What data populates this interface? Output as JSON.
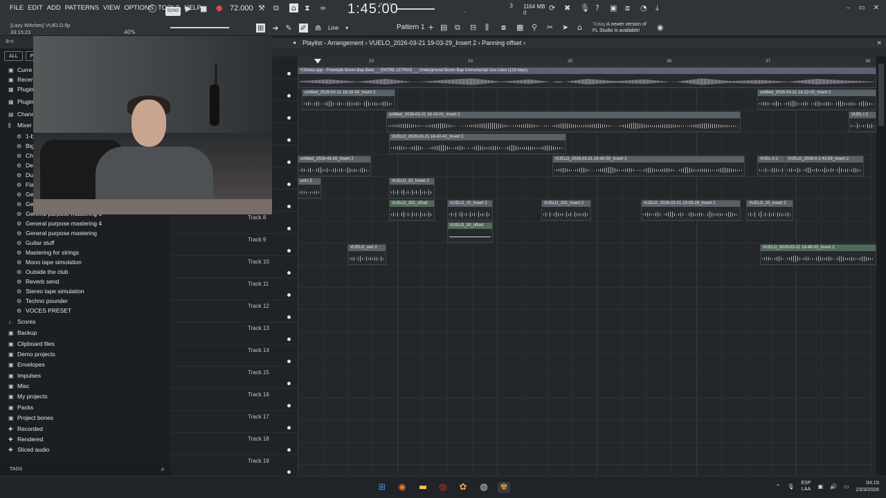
{
  "menu": [
    "FILE",
    "EDIT",
    "ADD",
    "PATTERNS",
    "VIEW",
    "OPTIONS",
    "TOOLS",
    "HELP"
  ],
  "transport": {
    "song_label": "SONG",
    "tempo": "72.000",
    "time": "1:45:00",
    "time_sub": "M:S:CS",
    "cpu": "3",
    "memory": "1164 MB",
    "memory_sub": "0"
  },
  "project": {
    "title": "[Lazy Witches] VUELO.flp",
    "elapsed": "33:15:23",
    "zoom": "40%"
  },
  "toolbar": {
    "snap": "Line",
    "pattern": "Pattern 1"
  },
  "news": {
    "label": "Today",
    "text": "A newer version of",
    "text2": "FL Studio is available!"
  },
  "browser": {
    "header": "Bro",
    "tabs": [
      "ALL",
      "P"
    ],
    "items": [
      {
        "icon": "folder",
        "label": "Curre"
      },
      {
        "icon": "folder",
        "label": "Recen"
      },
      {
        "icon": "plugin",
        "label": "Plugin"
      },
      {
        "icon": "plugin",
        "label": "Plugin"
      },
      {
        "icon": "channel",
        "label": "Chann"
      },
      {
        "icon": "mixer",
        "label": "Mixer"
      },
      {
        "icon": "gear",
        "label": "1-b"
      },
      {
        "icon": "gear",
        "label": "Big"
      },
      {
        "icon": "gear",
        "label": "Cho"
      },
      {
        "icon": "gear",
        "label": "Def"
      },
      {
        "icon": "gear",
        "label": "Dua"
      },
      {
        "icon": "gear",
        "label": "Fla"
      },
      {
        "icon": "gear",
        "label": "Gen"
      },
      {
        "icon": "gear",
        "label": "Gen"
      },
      {
        "icon": "gear",
        "label": "General purpose mastering 3"
      },
      {
        "icon": "gear",
        "label": "General purpose mastering 4"
      },
      {
        "icon": "gear",
        "label": "General purpose mastering"
      },
      {
        "icon": "gear",
        "label": "Guitar stuff"
      },
      {
        "icon": "gear",
        "label": "Mastering for strings"
      },
      {
        "icon": "gear",
        "label": "Mono tape simulation"
      },
      {
        "icon": "gear",
        "label": "Outside the club"
      },
      {
        "icon": "gear",
        "label": "Reverb send"
      },
      {
        "icon": "gear",
        "label": "Stereo tape simulation"
      },
      {
        "icon": "gear",
        "label": "Techno pounder"
      },
      {
        "icon": "gear",
        "label": "VOCES PRESET"
      },
      {
        "icon": "note",
        "label": "Scores"
      },
      {
        "icon": "folder",
        "label": "Backup"
      },
      {
        "icon": "folder",
        "label": "Clipboard files"
      },
      {
        "icon": "folder",
        "label": "Demo projects"
      },
      {
        "icon": "folder",
        "label": "Envelopes"
      },
      {
        "icon": "folder",
        "label": "Impulses"
      },
      {
        "icon": "folder",
        "label": "Misc"
      },
      {
        "icon": "folder",
        "label": "My projects"
      },
      {
        "icon": "folder",
        "label": "Packs"
      },
      {
        "icon": "folder",
        "label": "Project bones"
      },
      {
        "icon": "plus",
        "label": "Recorded"
      },
      {
        "icon": "plus",
        "label": "Rendered"
      },
      {
        "icon": "plus",
        "label": "Sliced audio"
      }
    ],
    "tags": "TAGS"
  },
  "playlist": {
    "title": "Playlist - Arrangement › VUELO_2026-03-21 19-03-29_Insert 2 › Panning offset ›",
    "bars": [
      "33",
      "34",
      "35",
      "36",
      "37",
      "38"
    ],
    "tracks": [
      "",
      "",
      "",
      "",
      "",
      "",
      "",
      "Track 8",
      "Track 9",
      "Track 10",
      "Track 11",
      "Track 12",
      "Track 13",
      "Track 14",
      "Track 15",
      "Track 16",
      "Track 17",
      "Track 18",
      "Track 19"
    ],
    "clips": [
      {
        "track": 0,
        "start": 0,
        "end": 836,
        "label": "Y2meta.app - Freestyle Boom Bap Beat _ _ENTRE LETRAS_ _ Underground Boom Bap Instrumental Uso Libre (128 kbps)",
        "kind": "long"
      },
      {
        "track": 1,
        "start": 6,
        "end": 141,
        "label": "untitled_2026-03-21 18-16-34_Insert 2",
        "kind": "audio"
      },
      {
        "track": 1,
        "start": 664,
        "end": 836,
        "label": "untitled_2026-03-21 18-22-00_Insert 2",
        "kind": "audio"
      },
      {
        "track": 2,
        "start": 128,
        "end": 640,
        "label": "untitled_2026-03-21 18-19-01_Insert 2",
        "kind": "audio"
      },
      {
        "track": 2,
        "start": 796,
        "end": 836,
        "label": "VUEL t 2",
        "kind": "audio"
      },
      {
        "track": 3,
        "start": 132,
        "end": 388,
        "label": "VUELO_2026-03-21 18-42-41_Insert 2",
        "kind": "audio"
      },
      {
        "track": 4,
        "start": 0,
        "end": 106,
        "label": "untitled_2026-43-16_Insert 2",
        "kind": "audio"
      },
      {
        "track": 4,
        "start": 368,
        "end": 646,
        "label": "VUELO_2026-03-21 18-42-59_Insert 2",
        "kind": "audio"
      },
      {
        "track": 4,
        "start": 664,
        "end": 706,
        "label": "VUEL rt 2",
        "kind": "audio"
      },
      {
        "track": 4,
        "start": 704,
        "end": 818,
        "label": "VUELO_2026-0-2 42-59_Insert 2",
        "kind": "audio"
      },
      {
        "track": 5,
        "start": 0,
        "end": 34,
        "label": "unt t 2",
        "kind": "audio"
      },
      {
        "track": 5,
        "start": 132,
        "end": 198,
        "label": "VUELO_20_Insert 2",
        "kind": "audio"
      },
      {
        "track": 6,
        "start": 132,
        "end": 198,
        "label": "VUELO_202_offset",
        "kind": "auto"
      },
      {
        "track": 6,
        "start": 216,
        "end": 282,
        "label": "VUELO_20_Insert 2",
        "kind": "audio"
      },
      {
        "track": 6,
        "start": 352,
        "end": 424,
        "label": "VUELO_202_Insert 2",
        "kind": "audio"
      },
      {
        "track": 6,
        "start": 496,
        "end": 640,
        "label": "VUELO_2026-03-21 19-03-29_Insert 2",
        "kind": "audio"
      },
      {
        "track": 6,
        "start": 648,
        "end": 716,
        "label": "VUELO_20_Insert 2",
        "kind": "audio"
      },
      {
        "track": 7,
        "start": 216,
        "end": 282,
        "label": "VUELO_20_offset",
        "kind": "auto"
      },
      {
        "track": 8,
        "start": 72,
        "end": 128,
        "label": "VUELO_sert 2",
        "kind": "audio"
      },
      {
        "track": 8,
        "start": 668,
        "end": 836,
        "label": "VUELO_2026-03-21 18-48-33_Insert 2",
        "kind": "auto"
      }
    ]
  },
  "taskbar": {
    "apps": [
      "windows-start",
      "firefox",
      "file-explorer",
      "chrome",
      "fl-studio-alt",
      "obs",
      "fl-studio"
    ],
    "lang1": "ESP",
    "lang2": "LAA",
    "time": "04:15",
    "date": "23/3/2026"
  }
}
